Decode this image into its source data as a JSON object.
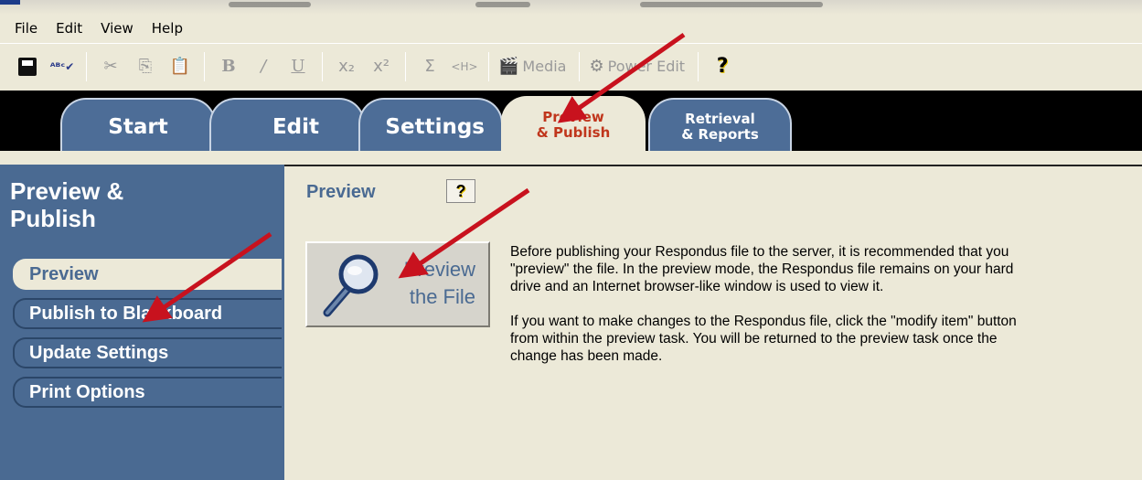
{
  "menu": [
    "File",
    "Edit",
    "View",
    "Help"
  ],
  "toolbar": {
    "media_label": "Media",
    "power_edit_label": "Power Edit",
    "icons": [
      "save-icon",
      "spellcheck-icon",
      "cut-icon",
      "copy-icon",
      "paste-icon",
      "bold-icon",
      "italic-icon",
      "underline-icon",
      "subscript-icon",
      "superscript-icon",
      "sigma-icon",
      "html-icon",
      "media-icon",
      "power-edit-icon",
      "help-icon"
    ]
  },
  "tabs": [
    {
      "label": "Start"
    },
    {
      "label": "Edit"
    },
    {
      "label": "Settings"
    },
    {
      "label": "Preview\n& Publish",
      "active": true
    },
    {
      "label": "Retrieval\n& Reports"
    }
  ],
  "sidebar": {
    "heading": "Preview &\nPublish",
    "items": [
      {
        "label": "Preview",
        "active": true
      },
      {
        "label": "Publish to Blackboard"
      },
      {
        "label": "Update Settings"
      },
      {
        "label": "Print Options"
      }
    ]
  },
  "main": {
    "title": "Preview",
    "help_label": "?",
    "preview_button_label": "Preview\nthe File",
    "paragraph1": "Before publishing your Respondus file to the server, it is recommended that you \"preview\" the file.  In the preview mode, the Respondus file remains on your hard drive and an Internet browser-like window is used to view it.",
    "paragraph2": "If you want to make changes to the Respondus file, click the \"modify item\" button from within the preview task.  You will be returned to the preview task once the change has been made."
  },
  "colors": {
    "tab_blue": "#4d6d97",
    "sidebar_blue": "#4a6a92",
    "active_tab_text": "#c0361c",
    "background": "#ece9d8",
    "annotation_arrow": "#c8121e"
  }
}
